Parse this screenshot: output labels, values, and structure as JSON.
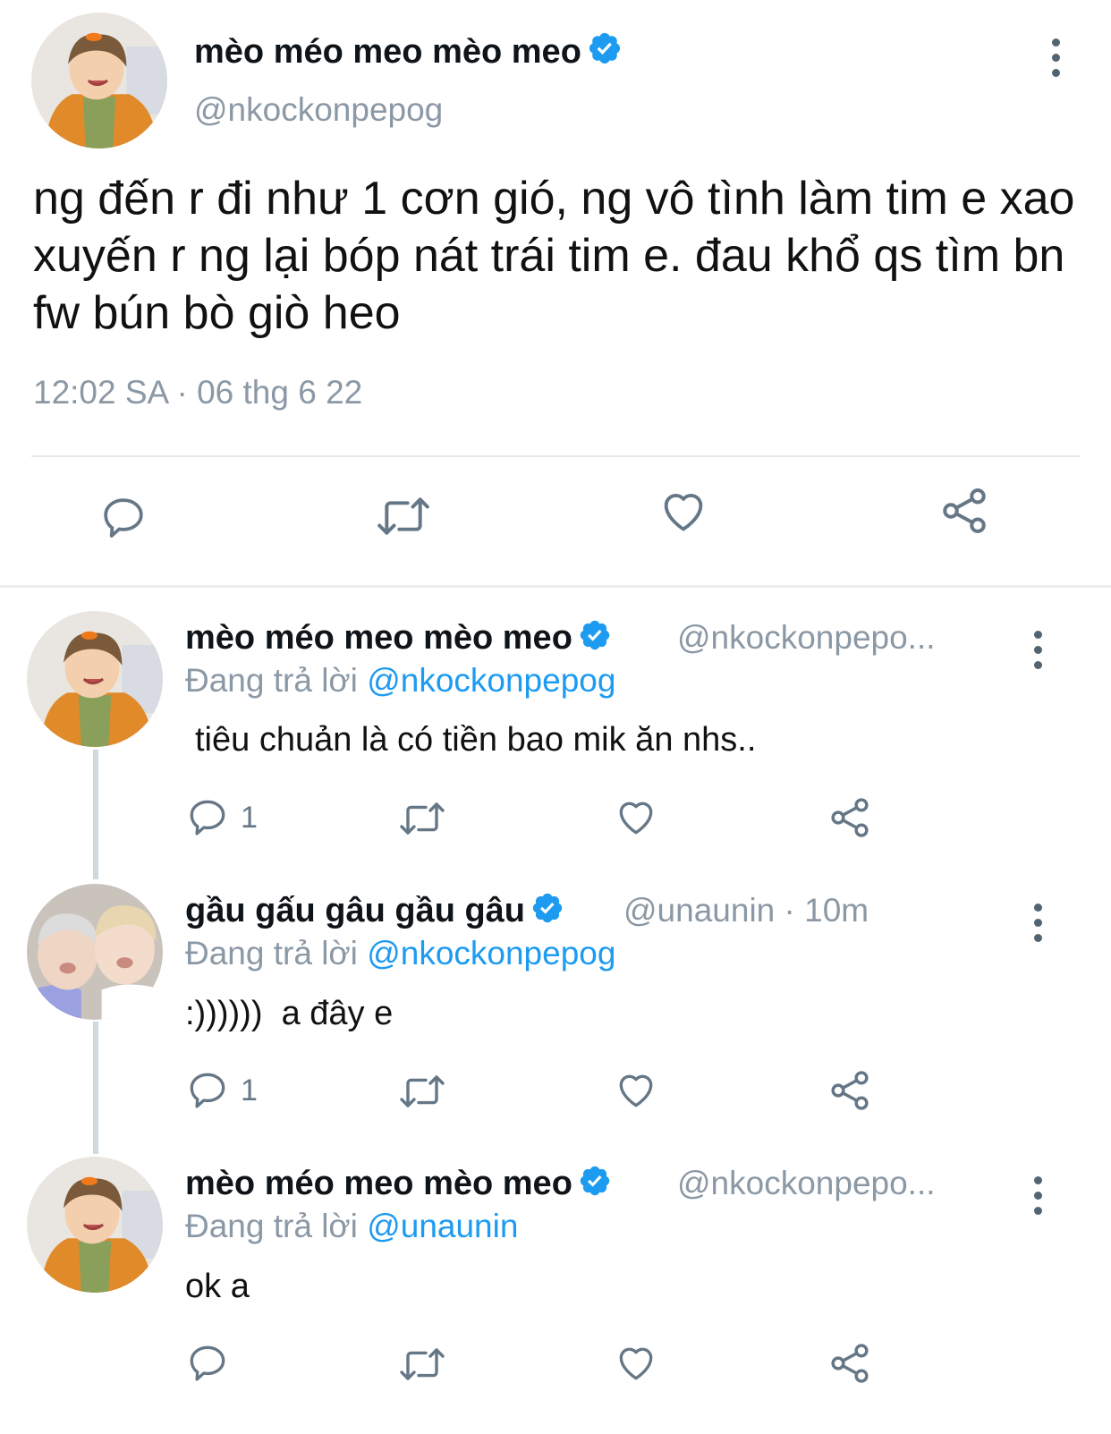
{
  "main_tweet": {
    "display_name": "mèo méo meo mèo meo",
    "handle": "@nkockonpepog",
    "text": "ng đến r đi như 1 cơn gió, ng vô tình làm tim e xao xuyến r ng lại bóp nát trái tim e. đau khổ qs tìm bn fw bún bò giò heo",
    "timestamp": "12:02 SA · 06 thg 6 22"
  },
  "replies": [
    {
      "display_name": "mèo méo meo mèo meo",
      "handle_meta": "@nkockonpepo...",
      "replying_prefix": "Đang trả lời",
      "replying_to": "@nkockonpepog",
      "text": "tiêu chuản là có tiền bao mik ăn nhs..",
      "reply_count": "1"
    },
    {
      "display_name": "gầu gấu gâu gầu gâu",
      "handle_meta": "@unaunin · 10m",
      "replying_prefix": "Đang trả lời",
      "replying_to": "@nkockonpepog",
      "text": ":))))))  a đây e",
      "reply_count": "1"
    },
    {
      "display_name": "mèo méo meo mèo meo",
      "handle_meta": "@nkockonpepo...",
      "replying_prefix": "Đang trả lời",
      "replying_to": "@unaunin",
      "text": "ok a",
      "reply_count": ""
    }
  ],
  "icons": {
    "verified": "verified-badge-icon",
    "reply": "reply-bubble-icon",
    "retweet": "retweet-icon",
    "like": "heart-icon",
    "share": "share-icon",
    "more": "more-vertical-icon"
  },
  "colors": {
    "accent": "#1d9bf0",
    "muted": "#8b98a5",
    "icon": "#657786",
    "text": "#0f1419"
  }
}
